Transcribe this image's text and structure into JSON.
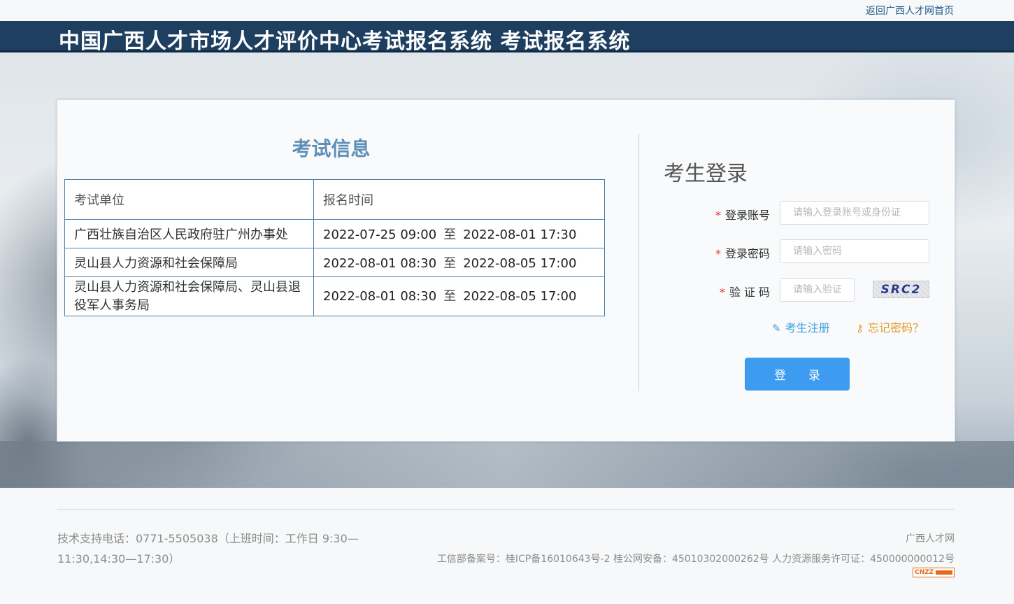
{
  "top_link": {
    "label": "返回广西人才网首页"
  },
  "header": {
    "title": "中国广西人才市场人才评价中心考试报名系统  考试报名系统"
  },
  "exam_info": {
    "title": "考试信息",
    "columns": [
      "考试单位",
      "报名时间"
    ],
    "rows": [
      {
        "unit": "广西壮族自治区人民政府驻广州办事处",
        "start": "2022-07-25 09:00",
        "sep": "至",
        "end": "2022-08-01 17:30"
      },
      {
        "unit": "灵山县人力资源和社会保障局",
        "start": "2022-08-01 08:30",
        "sep": "至",
        "end": "2022-08-05 17:00"
      },
      {
        "unit": "灵山县人力资源和社会保障局、灵山县退役军人事务局",
        "start": "2022-08-01 08:30",
        "sep": "至",
        "end": "2022-08-05 17:00"
      }
    ]
  },
  "login": {
    "title": "考生登录",
    "required_mark": "*",
    "account_label": "登录账号",
    "account_placeholder": "请输入登录账号或身份证",
    "password_label": "登录密码",
    "password_placeholder": "请输入密码",
    "captcha_label": "验 证 码",
    "captcha_placeholder": "请输入验证",
    "captcha_text": "SRC2",
    "register_label": "考生注册",
    "forgot_label": "忘记密码？",
    "submit_label": "登录"
  },
  "footer": {
    "support": "技术支持电话：0771-5505038（上班时间：工作日 9:30—11:30,14:30—17:30）",
    "site_name": "广西人才网",
    "icp": "工信部备案号：桂ICP备16010643号-2 桂公网安备：45010302000262号 人力资源服务许可证：450000000012号",
    "stat_badge": "CNZZ"
  },
  "colors": {
    "header_bg": "#1e3f60",
    "accent_blue": "#3d9cf0",
    "exam_title": "#5d8fb8",
    "forgot_orange": "#e39a2a",
    "required_red": "#e23b3b"
  }
}
